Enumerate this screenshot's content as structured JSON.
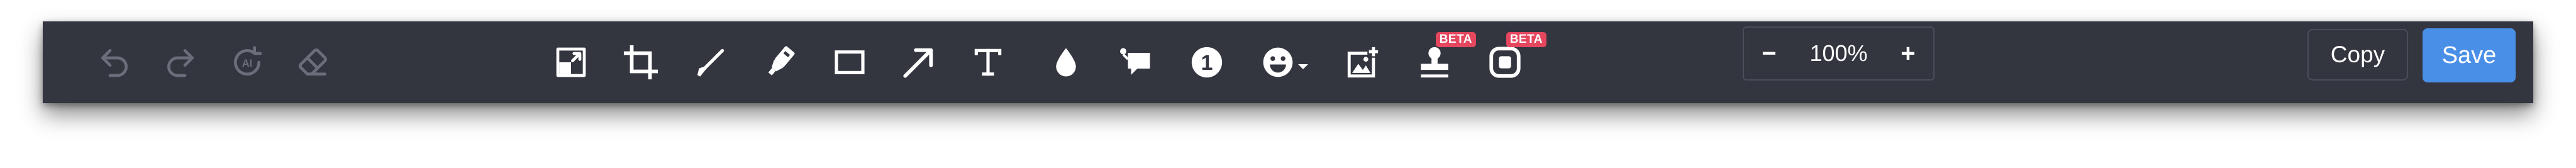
{
  "toolbar": {
    "history": [
      {
        "name": "undo-icon",
        "label": "Undo",
        "enabled": false
      },
      {
        "name": "redo-icon",
        "label": "Redo",
        "enabled": false
      },
      {
        "name": "auto-enhance-icon",
        "label": "AI",
        "enabled": false
      },
      {
        "name": "eraser-icon",
        "label": "Erase",
        "enabled": false
      }
    ],
    "tools": [
      {
        "name": "resize-icon"
      },
      {
        "name": "crop-icon"
      },
      {
        "name": "pen-icon"
      },
      {
        "name": "highlighter-icon"
      },
      {
        "name": "rectangle-icon"
      },
      {
        "name": "arrow-icon"
      },
      {
        "name": "text-icon"
      },
      {
        "name": "blur-drop-icon"
      },
      {
        "name": "callout-icon"
      },
      {
        "name": "step-number-icon",
        "number": "1"
      },
      {
        "name": "emoji-icon"
      },
      {
        "name": "add-image-icon"
      },
      {
        "name": "stamp-icon",
        "badge": "BETA"
      },
      {
        "name": "frame-icon",
        "badge": "BETA"
      }
    ],
    "zoom": {
      "decrease_label": "−",
      "value": "100%",
      "increase_label": "+"
    },
    "copy_label": "Copy",
    "save_label": "Save"
  },
  "colors": {
    "toolbar_bg": "#33353f",
    "icon_active": "#ffffff",
    "icon_disabled": "#6b6e7a",
    "save_bg": "#4a8fe7",
    "badge_bg": "#e5475f"
  }
}
